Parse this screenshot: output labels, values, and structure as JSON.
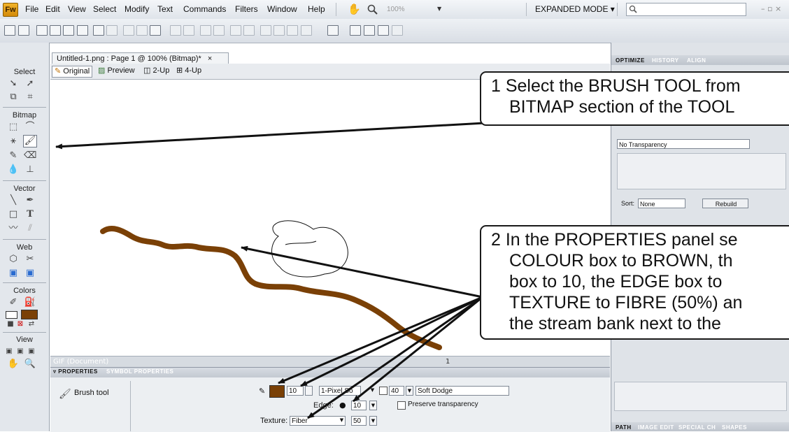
{
  "app": {
    "logo": "Fw",
    "menus": [
      "File",
      "Edit",
      "View",
      "Select",
      "Modify",
      "Text",
      "Commands",
      "Filters",
      "Window",
      "Help"
    ],
    "zoom": "100%",
    "mode": "EXPANDED MODE ▾",
    "window_controls": "– ▫ ×"
  },
  "document": {
    "tab_title": "Untitled-1.png : Page 1 @ 100% (Bitmap)*",
    "tab_close": "×",
    "views": [
      "Original",
      "Preview",
      "2-Up",
      "4-Up"
    ],
    "status_left": "GIF (Document)",
    "status_right": "1"
  },
  "tools": {
    "select_label": "Select",
    "bitmap_label": "Bitmap",
    "vector_label": "Vector",
    "web_label": "Web",
    "colors_label": "Colors",
    "view_label": "View"
  },
  "properties": {
    "tab_properties": "▿ PROPERTIES",
    "tab_symbol": "SYMBOL PROPERTIES",
    "tool_name": "Brush tool",
    "size": "10",
    "stroke_type": "1-Pixel So",
    "opacity": "40",
    "blend": "Soft Dodge",
    "edge_label": "Edge:",
    "edge": "10",
    "preserve_transparency": "Preserve transparency",
    "texture_label": "Texture:",
    "texture": "Fiber",
    "texture_amount": "50"
  },
  "right_panel": {
    "tabs": [
      "OPTIMIZE",
      "HISTORY",
      "ALIGN"
    ],
    "transparency": "No Transparency",
    "sort_label": "Sort:",
    "sort_value": "None",
    "rebuild": "Rebuild",
    "bottom_tabs": [
      "PATH",
      "IMAGE EDIT",
      "SPECIAL CH",
      "SHAPES"
    ]
  },
  "callouts": {
    "one_line1": "1  Select the BRUSH TOOL from",
    "one_line2": "BITMAP section of the TOOL",
    "two_line1": "2  In the PROPERTIES panel se",
    "two_line2": "COLOUR box to BROWN, th",
    "two_line3": "box to 10, the EDGE box to",
    "two_line4": "TEXTURE to FIBRE (50%) an",
    "two_line5": "the stream bank next to the"
  },
  "colors": {
    "brush_stroke": "#7a4006",
    "arrow": "#111111"
  }
}
